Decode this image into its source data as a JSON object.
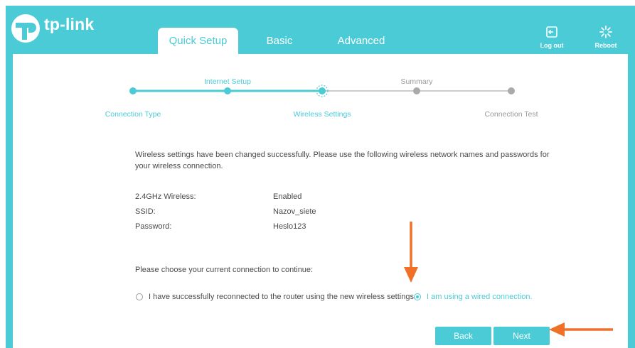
{
  "brand": {
    "name": "tp-link"
  },
  "tabs": [
    {
      "label": "Quick Setup",
      "active": true
    },
    {
      "label": "Basic",
      "active": false
    },
    {
      "label": "Advanced",
      "active": false
    }
  ],
  "header_actions": {
    "logout": "Log out",
    "reboot": "Reboot"
  },
  "progress": {
    "steps": [
      {
        "label": "Connection Type",
        "state": "done",
        "label_pos": "below"
      },
      {
        "label": "Internet Setup",
        "state": "done",
        "label_pos": "above"
      },
      {
        "label": "Wireless Settings",
        "state": "current",
        "label_pos": "below"
      },
      {
        "label": "Summary",
        "state": "pending",
        "label_pos": "above"
      },
      {
        "label": "Connection Test",
        "state": "pending",
        "label_pos": "below"
      }
    ]
  },
  "message": "Wireless settings have been changed successfully. Please use the following wireless network names and passwords for your wireless connection.",
  "wireless_info": [
    {
      "key": "2.4GHz Wireless:",
      "value": "Enabled"
    },
    {
      "key": "SSID:",
      "value": "Nazov_siete"
    },
    {
      "key": "Password:",
      "value": "Heslo123"
    }
  ],
  "prompt": "Please choose your current connection to continue:",
  "options": [
    {
      "label": "I have successfully reconnected to the router using the new wireless settings.",
      "checked": false
    },
    {
      "label": "I am using a wired connection.",
      "checked": true
    }
  ],
  "buttons": {
    "back": "Back",
    "next": "Next"
  },
  "colors": {
    "accent": "#4acbd6",
    "annotation": "#f07028",
    "pending": "#bbbbbb"
  }
}
